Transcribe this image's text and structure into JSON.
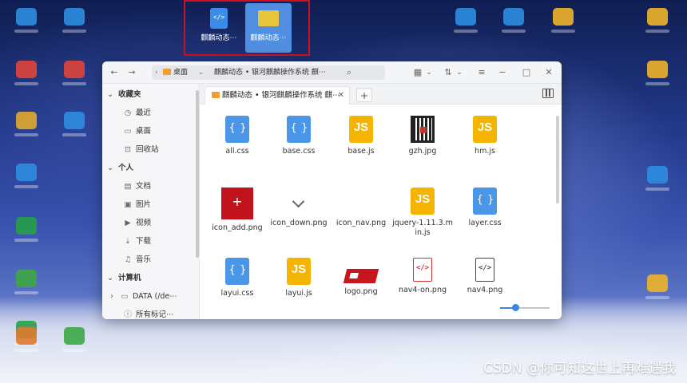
{
  "desktop": {
    "selected_items": [
      {
        "label": "麒麟动态⋯",
        "icon": "code-file-icon"
      },
      {
        "label": "麒麟动态⋯",
        "icon": "folder-icon"
      }
    ],
    "left_icons": [
      "#2e8de0",
      "#e0453a",
      "#e0a82e",
      "#2e8de0",
      "#26a048",
      "#3ca845",
      "#26a048",
      "#e07a2e"
    ],
    "right_icons": [
      "#2e8de0",
      "#2e8de0",
      "#f0b429",
      "#f0b429",
      "#f0b429",
      "#2e8de0",
      "#f0b429"
    ]
  },
  "window": {
    "path": {
      "location": "桌面",
      "sub_path": "麒麟动态 • 银河麒麟操作系统 麒⋯"
    },
    "controls": {
      "back": "←",
      "forward": "→",
      "search": "⌕",
      "view": "▦",
      "sort": "⇅",
      "menu": "≡",
      "minimize": "−",
      "maximize": "□",
      "close": "✕"
    },
    "sidebar": {
      "sections": [
        {
          "head": "收藏夹",
          "items": [
            {
              "label": "最近",
              "icon": "clock-icon",
              "glyph": "◷"
            },
            {
              "label": "桌面",
              "icon": "desktop-icon",
              "glyph": "▭"
            },
            {
              "label": "回收站",
              "icon": "trash-icon",
              "glyph": "⊡"
            }
          ]
        },
        {
          "head": "个人",
          "items": [
            {
              "label": "文档",
              "icon": "document-icon",
              "glyph": "▤"
            },
            {
              "label": "图片",
              "icon": "picture-icon",
              "glyph": "▣"
            },
            {
              "label": "视频",
              "icon": "video-icon",
              "glyph": "▶"
            },
            {
              "label": "下载",
              "icon": "download-icon",
              "glyph": "⤓"
            },
            {
              "label": "音乐",
              "icon": "music-icon",
              "glyph": "♫"
            }
          ]
        },
        {
          "head": "计算机",
          "items": [
            {
              "label": "DATA (/de⋯",
              "icon": "drive-icon",
              "glyph": "▭"
            },
            {
              "label": "所有标记⋯",
              "icon": "tag-icon",
              "glyph": "ⓘ"
            }
          ]
        }
      ]
    },
    "tab": {
      "label": "麒麟动态 • 银河麒麟操作系统 麒⋯",
      "close": "✕",
      "new": "+"
    },
    "files": [
      {
        "name": "all.css",
        "kind": "css"
      },
      {
        "name": "base.css",
        "kind": "css"
      },
      {
        "name": "base.js",
        "kind": "js"
      },
      {
        "name": "gzh.jpg",
        "kind": "qr"
      },
      {
        "name": "hm.js",
        "kind": "js"
      },
      {
        "name": "icon_add.png",
        "kind": "add"
      },
      {
        "name": "icon_down.png",
        "kind": "chev"
      },
      {
        "name": "icon_nav.png",
        "kind": "blank"
      },
      {
        "name": "jquery-1.11.3.min.js",
        "kind": "js"
      },
      {
        "name": "layer.css",
        "kind": "css"
      },
      {
        "name": "layui.css",
        "kind": "css"
      },
      {
        "name": "layui.js",
        "kind": "js"
      },
      {
        "name": "logo.png",
        "kind": "logo"
      },
      {
        "name": "nav4-on.png",
        "kind": "code-red"
      },
      {
        "name": "nav4.png",
        "kind": "code"
      }
    ],
    "zoom_level": 0.3
  },
  "watermark": "CSDN @你可知这世上再难遇我"
}
